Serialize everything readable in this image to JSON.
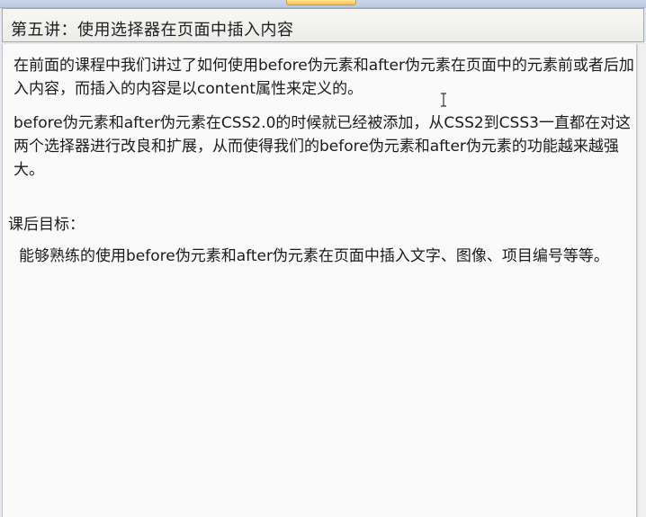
{
  "title": "第五讲：使用选择器在页面中插入内容",
  "paragraphs": [
    "在前面的课程中我们讲过了如何使用before伪元素和after伪元素在页面中的元素前或者后加入内容，而插入的内容是以content属性来定义的。",
    "before伪元素和after伪元素在CSS2.0的时候就已经被添加，从CSS2到CSS3一直都在对这两个选择器进行改良和扩展，从而使得我们的before伪元素和after伪元素的功能越来越强大。",
    "课后目标：",
    "能够熟练的使用before伪元素和after伪元素在页面中插入文字、图像、项目编号等等。"
  ],
  "icons": {
    "cursor": "text-cursor-icon"
  }
}
